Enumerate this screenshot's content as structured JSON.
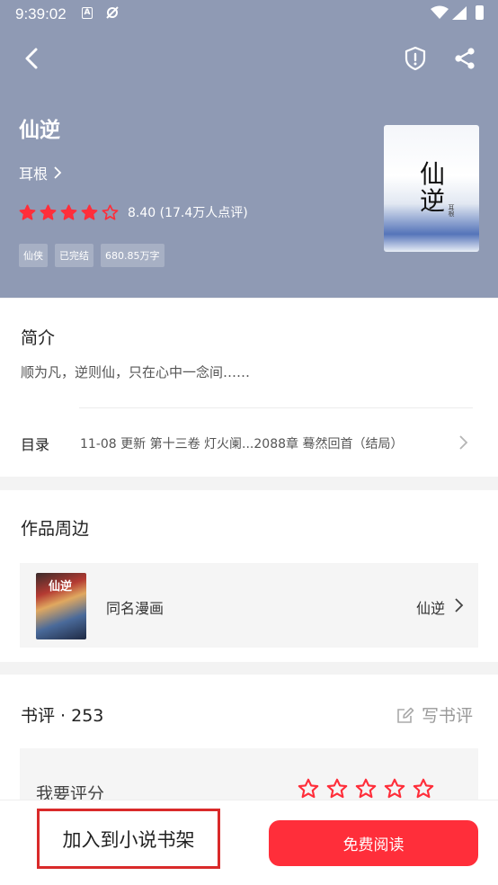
{
  "status_bar": {
    "time": "9:39:02",
    "a_icon": "A"
  },
  "header": {
    "back_icon": "chevron-left-icon",
    "report_icon": "shield-alert-icon",
    "share_icon": "share-icon"
  },
  "book": {
    "title": "仙逆",
    "author": "耳根",
    "rating_stars": 4,
    "rating_max": 5,
    "score_text": "8.40 (17.4万人点评)",
    "tags": [
      "仙侠",
      "已完结",
      "680.85万字"
    ],
    "cover_title": "仙逆",
    "cover_author": "耳根",
    "accent_color": "#ff2e3a",
    "hero_color": "#8f9ab4"
  },
  "intro": {
    "heading": "简介",
    "text": "顺为凡，逆则仙，只在心中一念间……"
  },
  "toc": {
    "label": "目录",
    "latest": "11-08  更新  第十三卷 灯火阑...2088章 蓦然回首（结局）"
  },
  "around": {
    "heading": "作品周边",
    "item_label": "同名漫画",
    "item_name": "仙逆",
    "thumb_title": "仙逆"
  },
  "reviews": {
    "heading": "书评 · 253",
    "write_label": "写书评",
    "rate_label": "我要评分",
    "rate_stars": 5
  },
  "bottom": {
    "add_shelf": "加入到小说书架",
    "read": "免费阅读"
  }
}
